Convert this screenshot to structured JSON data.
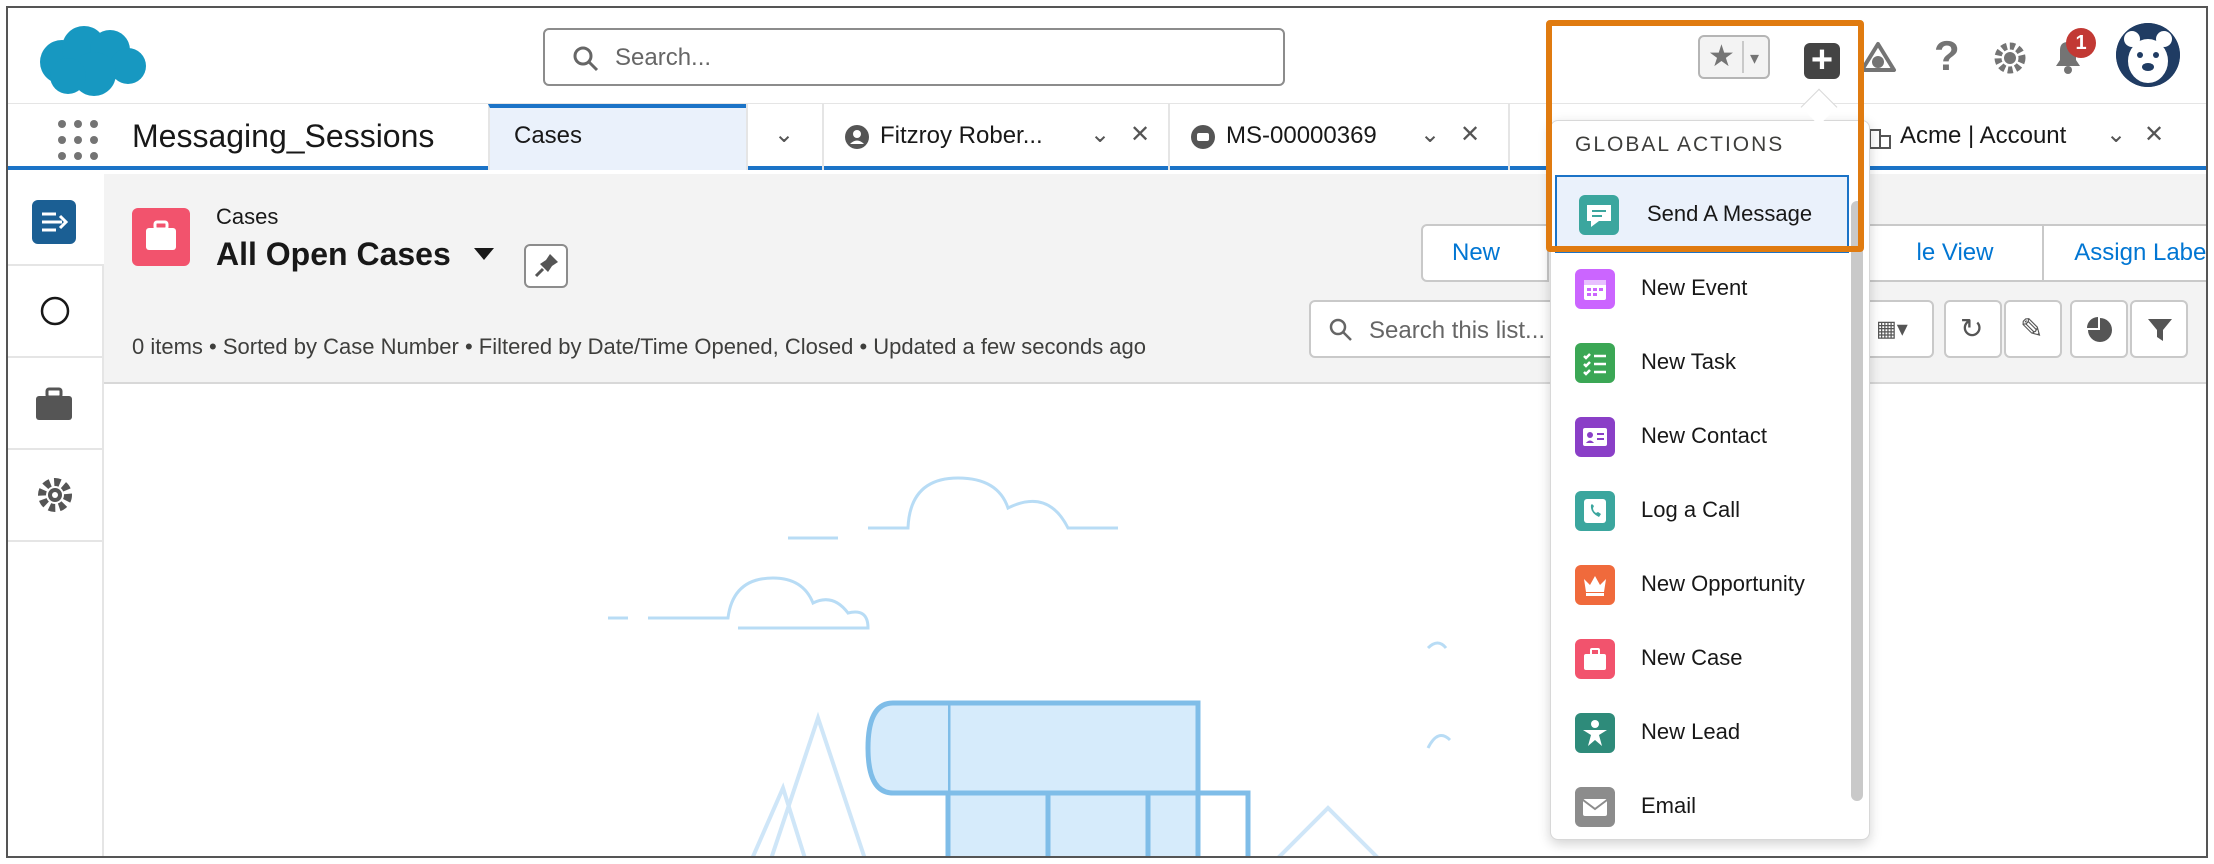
{
  "header": {
    "search_placeholder": "Search...",
    "notification_count": "1"
  },
  "nav": {
    "app_name": "Messaging_Sessions",
    "tabs": [
      {
        "label": "Cases"
      },
      {
        "label": "Fitzroy Rober..."
      },
      {
        "label": "MS-00000369"
      },
      {
        "label": "Acme | Account"
      }
    ]
  },
  "list": {
    "object_label": "Cases",
    "view_name": "All Open Cases",
    "meta": "0 items • Sorted by Case Number • Filtered by Date/Time Opened, Closed • Updated a few seconds ago",
    "buttons": {
      "new": "New",
      "le_view": "le View",
      "assign_label": "Assign Label"
    },
    "search_placeholder": "Search this list..."
  },
  "global_actions": {
    "heading": "GLOBAL ACTIONS",
    "items": [
      {
        "label": "Send A Message",
        "icon": "chat-icon",
        "color": "#3ba69e"
      },
      {
        "label": "New Event",
        "icon": "calendar-icon",
        "color": "#cb65ff"
      },
      {
        "label": "New Task",
        "icon": "task-icon",
        "color": "#3ba755"
      },
      {
        "label": "New Contact",
        "icon": "contact-icon",
        "color": "#8a3fc7"
      },
      {
        "label": "Log a Call",
        "icon": "phone-icon",
        "color": "#3ba69e"
      },
      {
        "label": "New Opportunity",
        "icon": "crown-icon",
        "color": "#f06a3c"
      },
      {
        "label": "New Case",
        "icon": "briefcase-icon",
        "color": "#f2536d"
      },
      {
        "label": "New Lead",
        "icon": "lead-icon",
        "color": "#2e8b7a"
      },
      {
        "label": "Email",
        "icon": "email-icon",
        "color": "#8c8c8c"
      }
    ]
  }
}
